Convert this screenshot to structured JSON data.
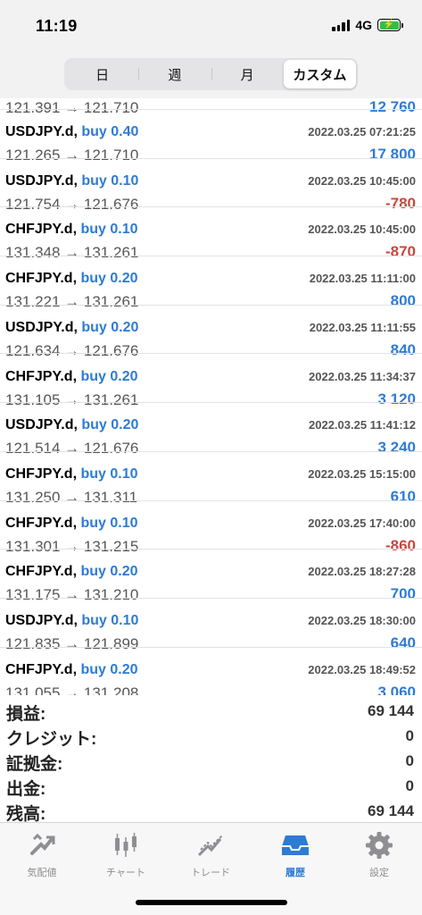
{
  "status": {
    "time": "11:19",
    "network": "4G"
  },
  "segments": [
    {
      "label": "日",
      "active": false
    },
    {
      "label": "週",
      "active": false
    },
    {
      "label": "月",
      "active": false
    },
    {
      "label": "カスタム",
      "active": true
    }
  ],
  "partial_row": {
    "prices": "121.391 → 121.710",
    "profit": "12 760"
  },
  "trades": [
    {
      "symbol": "USDJPY.d",
      "type": "buy 0.40",
      "datetime": "2022.03.25 07:21:25",
      "prices": "121.265 → 121.710",
      "profit": "17 800",
      "sign": "pos"
    },
    {
      "symbol": "USDJPY.d",
      "type": "buy 0.10",
      "datetime": "2022.03.25 10:45:00",
      "prices": "121.754 → 121.676",
      "profit": "-780",
      "sign": "neg"
    },
    {
      "symbol": "CHFJPY.d",
      "type": "buy 0.10",
      "datetime": "2022.03.25 10:45:00",
      "prices": "131.348 → 131.261",
      "profit": "-870",
      "sign": "neg"
    },
    {
      "symbol": "CHFJPY.d",
      "type": "buy 0.20",
      "datetime": "2022.03.25 11:11:00",
      "prices": "131.221 → 131.261",
      "profit": "800",
      "sign": "pos"
    },
    {
      "symbol": "USDJPY.d",
      "type": "buy 0.20",
      "datetime": "2022.03.25 11:11:55",
      "prices": "121.634 → 121.676",
      "profit": "840",
      "sign": "pos"
    },
    {
      "symbol": "CHFJPY.d",
      "type": "buy 0.20",
      "datetime": "2022.03.25 11:34:37",
      "prices": "131.105 → 131.261",
      "profit": "3 120",
      "sign": "pos"
    },
    {
      "symbol": "USDJPY.d",
      "type": "buy 0.20",
      "datetime": "2022.03.25 11:41:12",
      "prices": "121.514 → 121.676",
      "profit": "3 240",
      "sign": "pos"
    },
    {
      "symbol": "CHFJPY.d",
      "type": "buy 0.10",
      "datetime": "2022.03.25 15:15:00",
      "prices": "131.250 → 131.311",
      "profit": "610",
      "sign": "pos"
    },
    {
      "symbol": "CHFJPY.d",
      "type": "buy 0.10",
      "datetime": "2022.03.25 17:40:00",
      "prices": "131.301 → 131.215",
      "profit": "-860",
      "sign": "neg"
    },
    {
      "symbol": "CHFJPY.d",
      "type": "buy 0.20",
      "datetime": "2022.03.25 18:27:28",
      "prices": "131.175 → 131.210",
      "profit": "700",
      "sign": "pos"
    },
    {
      "symbol": "USDJPY.d",
      "type": "buy 0.10",
      "datetime": "2022.03.25 18:30:00",
      "prices": "121.835 → 121.899",
      "profit": "640",
      "sign": "pos"
    },
    {
      "symbol": "CHFJPY.d",
      "type": "buy 0.20",
      "datetime": "2022.03.25 18:49:52",
      "prices": "131.055 → 131.208",
      "profit": "3 060",
      "sign": "pos"
    }
  ],
  "summary": [
    {
      "label": "損益:",
      "value": "69 144"
    },
    {
      "label": "クレジット:",
      "value": "0"
    },
    {
      "label": "証拠金:",
      "value": "0"
    },
    {
      "label": "出金:",
      "value": "0"
    },
    {
      "label": "残高:",
      "value": "69 144"
    }
  ],
  "tabs": [
    {
      "label": "気配値",
      "icon": "quotes-icon",
      "active": false
    },
    {
      "label": "チャート",
      "icon": "candlestick-chart-icon",
      "active": false
    },
    {
      "label": "トレード",
      "icon": "trade-icon",
      "active": false
    },
    {
      "label": "履歴",
      "icon": "history-inbox-icon",
      "active": true
    },
    {
      "label": "設定",
      "icon": "gear-icon",
      "active": false
    }
  ],
  "colors": {
    "accent": "#2e7bd4",
    "loss": "#c9463d",
    "inactive": "#8e8e93"
  }
}
